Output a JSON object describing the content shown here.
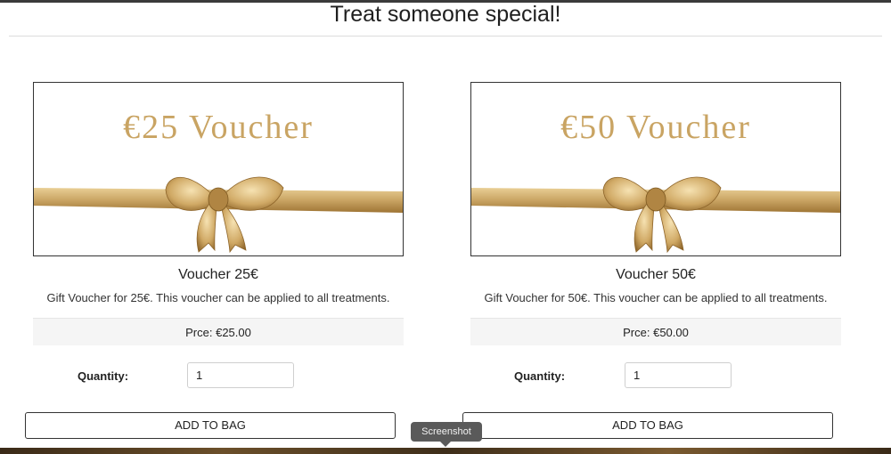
{
  "page": {
    "title": "Treat someone special!"
  },
  "vouchers": [
    {
      "image_text": "€25 Voucher",
      "title": "Voucher 25€",
      "description": "Gift Voucher for 25€. This voucher can be applied to all treatments.",
      "price": "Prce: €25.00",
      "quantity_label": "Quantity:",
      "quantity_value": "1",
      "button_label": "ADD TO BAG"
    },
    {
      "image_text": "€50 Voucher",
      "title": "Voucher 50€",
      "description": "Gift Voucher for 50€. This voucher can be applied to all treatments.",
      "price": "Prce: €50.00",
      "quantity_label": "Quantity:",
      "quantity_value": "1",
      "button_label": "ADD TO BAG"
    }
  ],
  "tooltip": {
    "text": "Screenshot"
  },
  "colors": {
    "gold": "#c9a463",
    "gold_dark": "#a67c3a",
    "border": "#333333",
    "price_bg": "#f5f5f5"
  },
  "icons": {
    "bow": "gold-ribbon-bow-icon"
  }
}
